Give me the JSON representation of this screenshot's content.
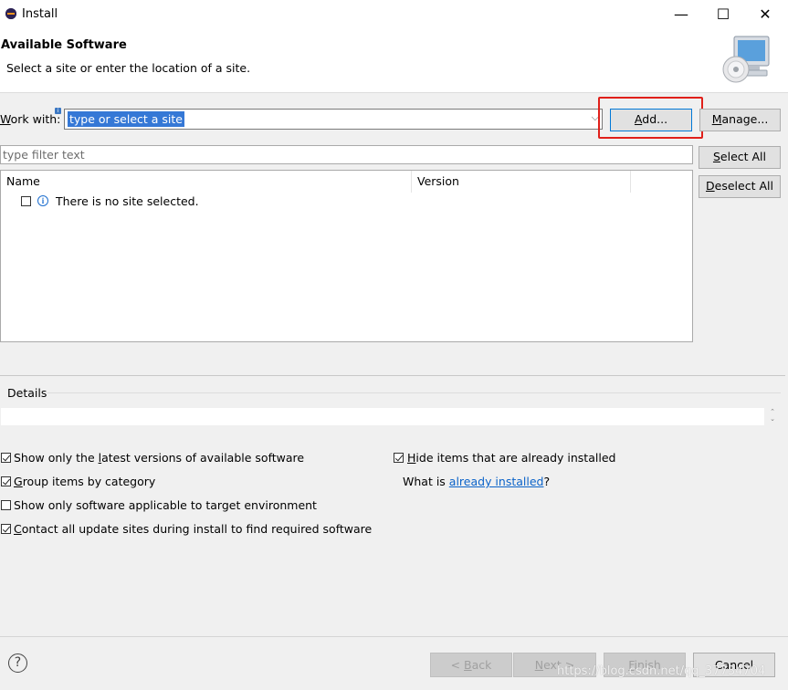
{
  "window": {
    "title": "Install",
    "minimize_glyph": "—",
    "maximize_glyph": "☐",
    "close_glyph": "✕"
  },
  "header": {
    "title": "Available Software",
    "subtitle": "Select a site or enter the location of a site."
  },
  "work_with": {
    "label_underlined": "W",
    "label_rest": "ork with:",
    "value": "type or select a site",
    "add_underlined": "A",
    "add_rest": "dd...",
    "manage_underlined": "M",
    "manage_rest": "anage..."
  },
  "filter": {
    "placeholder": "type filter text",
    "select_all_underlined": "S",
    "select_all_rest": "elect All",
    "deselect_all_underlined": "D",
    "deselect_all_rest": "eselect All"
  },
  "table": {
    "columns": [
      "Name",
      "Version"
    ],
    "rows": [
      {
        "checked": false,
        "text": "There is no site selected."
      }
    ]
  },
  "details": {
    "label": "Details"
  },
  "options": {
    "latest_versions": {
      "checked": true,
      "pre": "Show only the ",
      "u": "l",
      "post": "atest versions of available software"
    },
    "group_by_category": {
      "checked": true,
      "pre": "",
      "u": "G",
      "post": "roup items by category"
    },
    "target_env": {
      "checked": false,
      "pre": "Show only software applicable to target environment",
      "u": "",
      "post": ""
    },
    "contact_sites": {
      "checked": true,
      "pre": "",
      "u": "C",
      "post": "ontact all update sites during install to find required software"
    },
    "hide_installed": {
      "checked": true,
      "pre": "",
      "u": "H",
      "post": "ide items that are already installed"
    },
    "what_is_pre": "What is ",
    "what_is_link": "already installed",
    "what_is_post": "?"
  },
  "footer": {
    "back_pre": "< ",
    "back_u": "B",
    "back_post": "ack",
    "next_u": "N",
    "next_post": "ext >",
    "finish_u": "F",
    "finish_post": "inish",
    "cancel": "Cancel"
  },
  "watermark": "https://blog.csdn.net/qq_37734704",
  "colors": {
    "selection": "#3578d6",
    "highlight_box": "#e0201a",
    "link": "#0b63c9"
  }
}
